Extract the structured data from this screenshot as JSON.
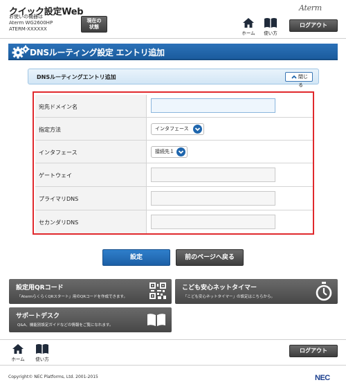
{
  "header": {
    "app_title": "クイック設定Web",
    "device_lines": [
      "お使いの機器は",
      "Aterm WG2600HP",
      "ATERM-XXXXXX"
    ],
    "status_button": [
      "現在の",
      "状態"
    ],
    "brand": "Aterm",
    "home_label": "ホーム",
    "help_label": "使い方",
    "logout_label": "ログアウト"
  },
  "page": {
    "title": "DNSルーティング設定 エントリ追加"
  },
  "section": {
    "title": "DNSルーティングエントリ追加",
    "close_label": "閉じる"
  },
  "form": {
    "domain_label": "宛先ドメイン名",
    "domain_value": "",
    "method_label": "指定方法",
    "method_value": "インタフェース",
    "interface_label": "インタフェース",
    "interface_value": "接続先１",
    "gateway_label": "ゲートウェイ",
    "gateway_value": "",
    "primary_dns_label": "プライマリDNS",
    "primary_dns_value": "",
    "secondary_dns_label": "セカンダリDNS",
    "secondary_dns_value": ""
  },
  "actions": {
    "submit_label": "設定",
    "back_label": "前のページへ戻る"
  },
  "tiles": {
    "qr_title": "設定用QRコード",
    "qr_desc": "「AtermらくらくQRスタート」用のQRコードを作成できます。",
    "timer_title": "こども安心ネットタイマー",
    "timer_desc": "「こども安心ネットタイマー」の設定はこちらから。",
    "support_title": "サポートデスク",
    "support_desc": "Q&A、機能別設定ガイドなどの情報をご覧になれます。"
  },
  "footer": {
    "home_label": "ホーム",
    "help_label": "使い方",
    "logout_label": "ログアウト",
    "copyright": "Copyright© NEC Platforms, Ltd. 2001-2015",
    "nec_logo": "NEC"
  },
  "colors": {
    "primary_blue": "#1f66ad",
    "highlight_red": "#e0282c",
    "dark_button": "#4a4a4a"
  }
}
